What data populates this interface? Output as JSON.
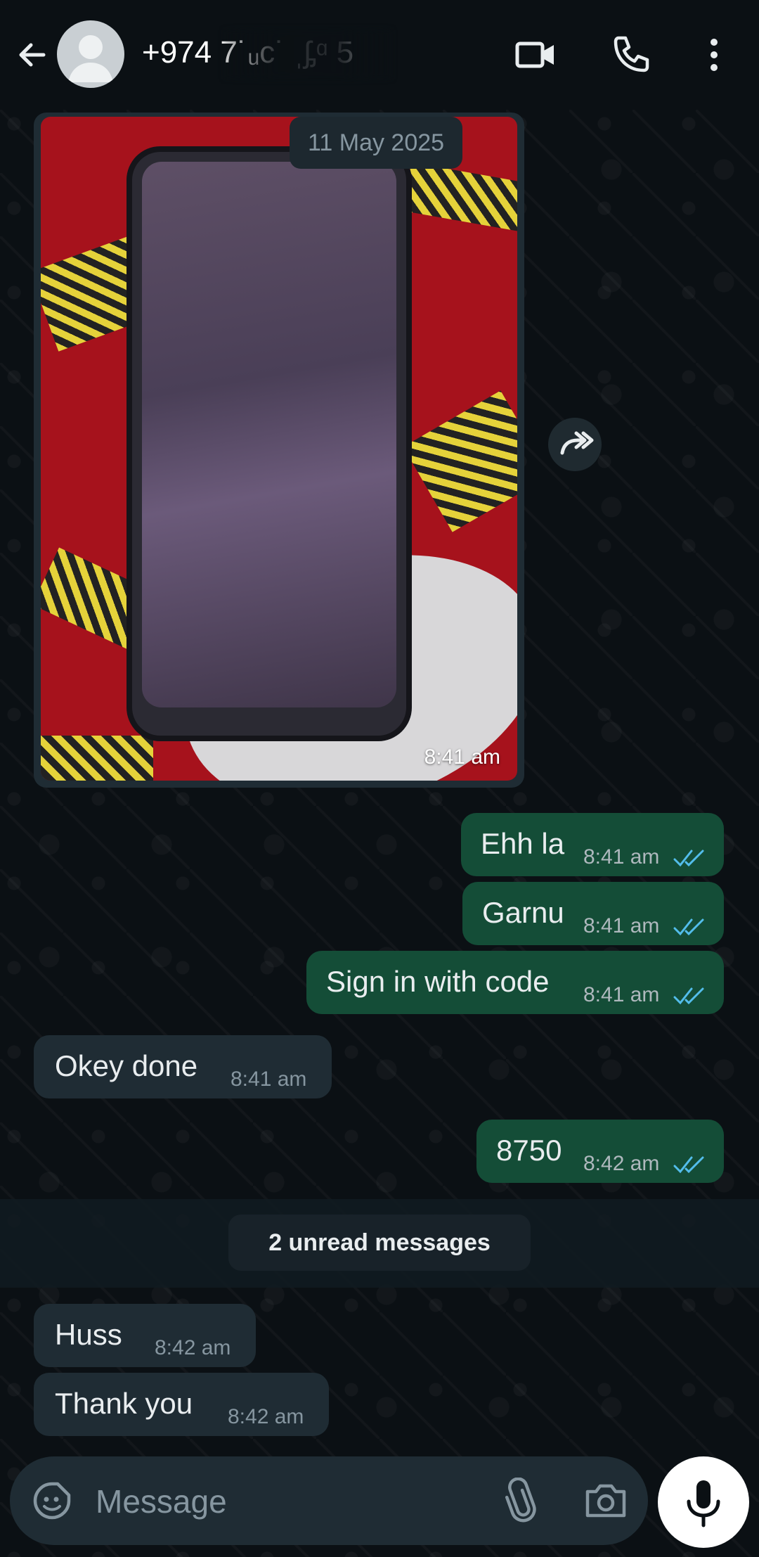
{
  "header": {
    "contact_name": "+974 7˙ᵤᴄ˙ ˌᶋᵅ 5",
    "icons": [
      "back-arrow-icon",
      "video-call-icon",
      "voice-call-icon",
      "more-options-icon"
    ]
  },
  "conversation": {
    "date_label": "11 May 2025",
    "image_message": {
      "time": "8:41 am"
    },
    "messages": [
      {
        "direction": "out",
        "text": "Ehh la",
        "time": "8:41 am",
        "status": "read"
      },
      {
        "direction": "out",
        "text": "Garnu",
        "time": "8:41 am",
        "status": "read"
      },
      {
        "direction": "out",
        "text": "Sign in with code",
        "time": "8:41 am",
        "status": "read"
      },
      {
        "direction": "in",
        "text": "Okey done",
        "time": "8:41 am"
      },
      {
        "direction": "out",
        "text": "8750",
        "time": "8:42 am",
        "status": "read"
      },
      {
        "direction": "in",
        "text": "Huss",
        "time": "8:42 am"
      },
      {
        "direction": "in",
        "text": "Thank you",
        "time": "8:42 am"
      }
    ],
    "unread_label": "2 unread messages"
  },
  "composer": {
    "placeholder": "Message",
    "icons": [
      "sticker-icon",
      "attach-icon",
      "camera-icon",
      "mic-icon"
    ]
  },
  "colors": {
    "background": "#0b1014",
    "outgoing_bubble": "#144d37",
    "incoming_bubble": "#1f2c34",
    "read_ticks": "#53bdeb"
  }
}
